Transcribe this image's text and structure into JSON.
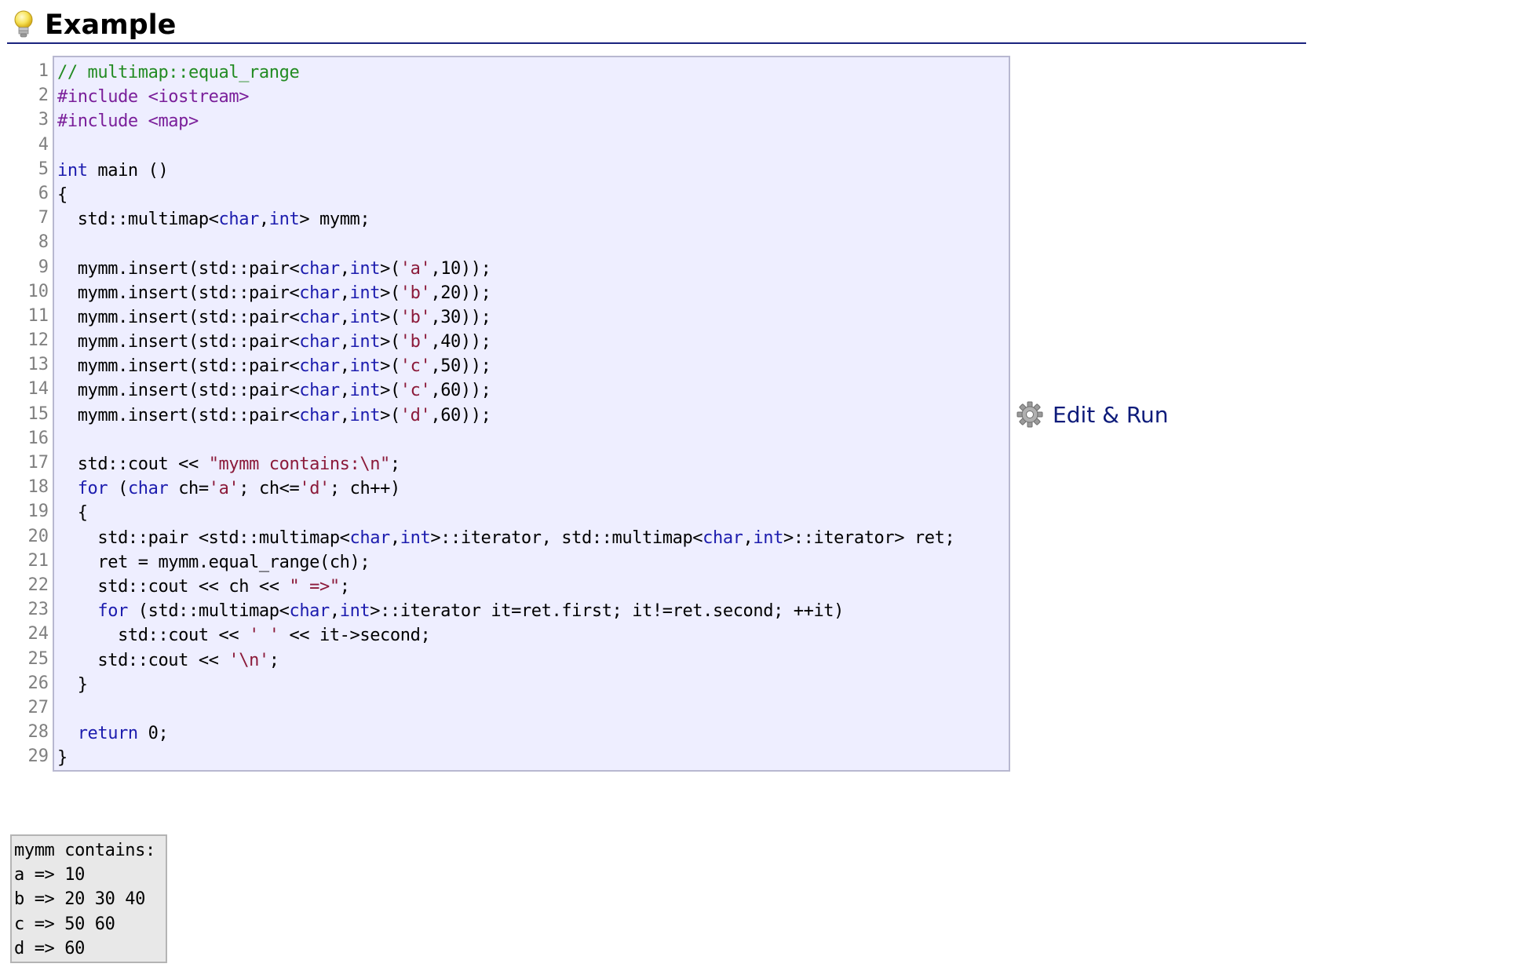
{
  "heading": {
    "title": "Example",
    "icon": "lightbulb-icon"
  },
  "code": {
    "line_numbers": [
      "1",
      "2",
      "3",
      "4",
      "5",
      "6",
      "7",
      "8",
      "9",
      "10",
      "11",
      "12",
      "13",
      "14",
      "15",
      "16",
      "17",
      "18",
      "19",
      "20",
      "21",
      "22",
      "23",
      "24",
      "25",
      "26",
      "27",
      "28",
      "29"
    ],
    "lines": [
      [
        {
          "t": "// multimap::equal_range",
          "c": "comment"
        }
      ],
      [
        {
          "t": "#include <iostream>",
          "c": "pre"
        }
      ],
      [
        {
          "t": "#include <map>",
          "c": "pre"
        }
      ],
      [],
      [
        {
          "t": "int",
          "c": "kw"
        },
        {
          "t": " main ()",
          "c": "plain"
        }
      ],
      [
        {
          "t": "{",
          "c": "plain"
        }
      ],
      [
        {
          "t": "  std::multimap<",
          "c": "plain"
        },
        {
          "t": "char",
          "c": "kw"
        },
        {
          "t": ",",
          "c": "plain"
        },
        {
          "t": "int",
          "c": "kw"
        },
        {
          "t": "> mymm;",
          "c": "plain"
        }
      ],
      [],
      [
        {
          "t": "  mymm.insert(std::pair<",
          "c": "plain"
        },
        {
          "t": "char",
          "c": "kw"
        },
        {
          "t": ",",
          "c": "plain"
        },
        {
          "t": "int",
          "c": "kw"
        },
        {
          "t": ">(",
          "c": "plain"
        },
        {
          "t": "'a'",
          "c": "str"
        },
        {
          "t": ",10));",
          "c": "plain"
        }
      ],
      [
        {
          "t": "  mymm.insert(std::pair<",
          "c": "plain"
        },
        {
          "t": "char",
          "c": "kw"
        },
        {
          "t": ",",
          "c": "plain"
        },
        {
          "t": "int",
          "c": "kw"
        },
        {
          "t": ">(",
          "c": "plain"
        },
        {
          "t": "'b'",
          "c": "str"
        },
        {
          "t": ",20));",
          "c": "plain"
        }
      ],
      [
        {
          "t": "  mymm.insert(std::pair<",
          "c": "plain"
        },
        {
          "t": "char",
          "c": "kw"
        },
        {
          "t": ",",
          "c": "plain"
        },
        {
          "t": "int",
          "c": "kw"
        },
        {
          "t": ">(",
          "c": "plain"
        },
        {
          "t": "'b'",
          "c": "str"
        },
        {
          "t": ",30));",
          "c": "plain"
        }
      ],
      [
        {
          "t": "  mymm.insert(std::pair<",
          "c": "plain"
        },
        {
          "t": "char",
          "c": "kw"
        },
        {
          "t": ",",
          "c": "plain"
        },
        {
          "t": "int",
          "c": "kw"
        },
        {
          "t": ">(",
          "c": "plain"
        },
        {
          "t": "'b'",
          "c": "str"
        },
        {
          "t": ",40));",
          "c": "plain"
        }
      ],
      [
        {
          "t": "  mymm.insert(std::pair<",
          "c": "plain"
        },
        {
          "t": "char",
          "c": "kw"
        },
        {
          "t": ",",
          "c": "plain"
        },
        {
          "t": "int",
          "c": "kw"
        },
        {
          "t": ">(",
          "c": "plain"
        },
        {
          "t": "'c'",
          "c": "str"
        },
        {
          "t": ",50));",
          "c": "plain"
        }
      ],
      [
        {
          "t": "  mymm.insert(std::pair<",
          "c": "plain"
        },
        {
          "t": "char",
          "c": "kw"
        },
        {
          "t": ",",
          "c": "plain"
        },
        {
          "t": "int",
          "c": "kw"
        },
        {
          "t": ">(",
          "c": "plain"
        },
        {
          "t": "'c'",
          "c": "str"
        },
        {
          "t": ",60));",
          "c": "plain"
        }
      ],
      [
        {
          "t": "  mymm.insert(std::pair<",
          "c": "plain"
        },
        {
          "t": "char",
          "c": "kw"
        },
        {
          "t": ",",
          "c": "plain"
        },
        {
          "t": "int",
          "c": "kw"
        },
        {
          "t": ">(",
          "c": "plain"
        },
        {
          "t": "'d'",
          "c": "str"
        },
        {
          "t": ",60));",
          "c": "plain"
        }
      ],
      [],
      [
        {
          "t": "  std::cout << ",
          "c": "plain"
        },
        {
          "t": "\"mymm contains:\\n\"",
          "c": "str"
        },
        {
          "t": ";",
          "c": "plain"
        }
      ],
      [
        {
          "t": "  ",
          "c": "plain"
        },
        {
          "t": "for",
          "c": "kw"
        },
        {
          "t": " (",
          "c": "plain"
        },
        {
          "t": "char",
          "c": "kw"
        },
        {
          "t": " ch=",
          "c": "plain"
        },
        {
          "t": "'a'",
          "c": "str"
        },
        {
          "t": "; ch<=",
          "c": "plain"
        },
        {
          "t": "'d'",
          "c": "str"
        },
        {
          "t": "; ch++)",
          "c": "plain"
        }
      ],
      [
        {
          "t": "  {",
          "c": "plain"
        }
      ],
      [
        {
          "t": "    std::pair <std::multimap<",
          "c": "plain"
        },
        {
          "t": "char",
          "c": "kw"
        },
        {
          "t": ",",
          "c": "plain"
        },
        {
          "t": "int",
          "c": "kw"
        },
        {
          "t": ">::iterator, std::multimap<",
          "c": "plain"
        },
        {
          "t": "char",
          "c": "kw"
        },
        {
          "t": ",",
          "c": "plain"
        },
        {
          "t": "int",
          "c": "kw"
        },
        {
          "t": ">::iterator> ret;",
          "c": "plain"
        }
      ],
      [
        {
          "t": "    ret = mymm.equal_range(ch);",
          "c": "plain"
        }
      ],
      [
        {
          "t": "    std::cout << ch << ",
          "c": "plain"
        },
        {
          "t": "\" =>\"",
          "c": "str"
        },
        {
          "t": ";",
          "c": "plain"
        }
      ],
      [
        {
          "t": "    ",
          "c": "plain"
        },
        {
          "t": "for",
          "c": "kw"
        },
        {
          "t": " (std::multimap<",
          "c": "plain"
        },
        {
          "t": "char",
          "c": "kw"
        },
        {
          "t": ",",
          "c": "plain"
        },
        {
          "t": "int",
          "c": "kw"
        },
        {
          "t": ">::iterator it=ret.first; it!=ret.second; ++it)",
          "c": "plain"
        }
      ],
      [
        {
          "t": "      std::cout << ",
          "c": "plain"
        },
        {
          "t": "' '",
          "c": "str"
        },
        {
          "t": " << it->second;",
          "c": "plain"
        }
      ],
      [
        {
          "t": "    std::cout << ",
          "c": "plain"
        },
        {
          "t": "'\\n'",
          "c": "str"
        },
        {
          "t": ";",
          "c": "plain"
        }
      ],
      [
        {
          "t": "  }",
          "c": "plain"
        }
      ],
      [],
      [
        {
          "t": "  ",
          "c": "plain"
        },
        {
          "t": "return",
          "c": "kw"
        },
        {
          "t": " 0;",
          "c": "plain"
        }
      ],
      [
        {
          "t": "}",
          "c": "plain"
        }
      ]
    ]
  },
  "edit_run": {
    "label": "Edit & Run",
    "icon": "gear-icon"
  },
  "output": {
    "lines": [
      "mymm contains:",
      "a => 10",
      "b => 20 30 40",
      "c => 50 60",
      "d => 60"
    ]
  },
  "colors": {
    "code_background": "#eeeeff",
    "comment": "#228b22",
    "preprocessor": "#7a1f9a",
    "keyword": "#1c1cae",
    "string": "#8b1a3a",
    "heading_rule": "#1a237e",
    "link": "#0d1b7a",
    "output_background": "#e8e8e8"
  }
}
